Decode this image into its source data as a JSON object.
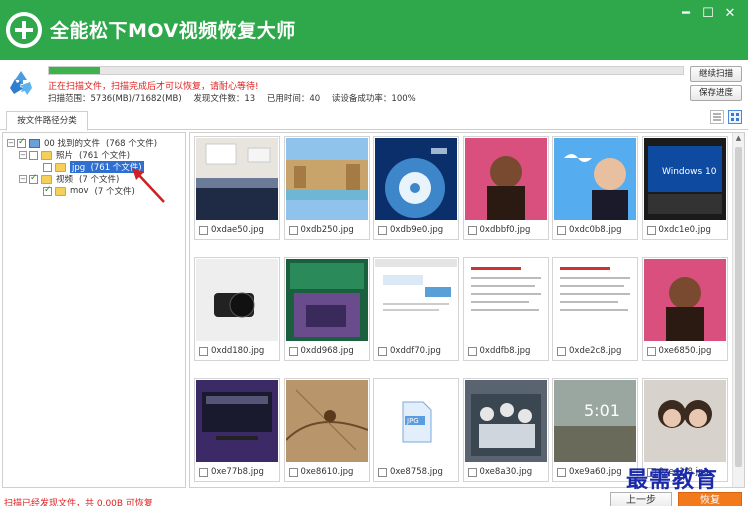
{
  "window": {
    "title": "全能松下MOV视频恢复大师",
    "brand_color": "#2ea84a"
  },
  "scan": {
    "progress": 0.08,
    "warning": "正在扫描文件，扫描完成后才可以恢复，请耐心等待!",
    "range": "扫描范围：5736(MB)/71682(MB)",
    "found": "发现文件数：13",
    "elapsed": "已用时间：40",
    "read_rate": "读设备成功率：100%",
    "continue_label": "继续扫描",
    "save_progress_label": "保存进度"
  },
  "tabs": [
    {
      "label": "按文件路径分类",
      "active": true
    }
  ],
  "tree": {
    "root": {
      "label": "00 找到的文件",
      "count": "(768 个文件)"
    },
    "pictures": {
      "label": "照片",
      "count": "(761 个文件)"
    },
    "jpg": {
      "label": "jpg",
      "count": "(761 个文件)"
    },
    "videos": {
      "label": "视频",
      "count": "(7 个文件)"
    },
    "mov": {
      "label": "mov",
      "count": "(7 个文件)"
    }
  },
  "thumbnails": [
    {
      "name": "0xdae50.jpg",
      "icon": "kitchen-photo"
    },
    {
      "name": "0xdb250.jpg",
      "icon": "fountain-photo"
    },
    {
      "name": "0xdb9e0.jpg",
      "icon": "satellite-photo"
    },
    {
      "name": "0xdbbf0.jpg",
      "icon": "portrait-photo"
    },
    {
      "name": "0xdc0b8.jpg",
      "icon": "twitter-photo"
    },
    {
      "name": "0xdc1e0.jpg",
      "icon": "windows-screenshot"
    },
    {
      "name": "0xdd180.jpg",
      "icon": "camera-photo"
    },
    {
      "name": "0xdd968.jpg",
      "icon": "poster-image"
    },
    {
      "name": "0xddf70.jpg",
      "icon": "webpage-screenshot"
    },
    {
      "name": "0xddfb8.jpg",
      "icon": "document-screenshot"
    },
    {
      "name": "0xde2c8.jpg",
      "icon": "document-screenshot"
    },
    {
      "name": "0xe6850.jpg",
      "icon": "portrait-photo"
    },
    {
      "name": "0xe77b8.jpg",
      "icon": "desktop-screenshot"
    },
    {
      "name": "0xe8610.jpg",
      "icon": "map-photo"
    },
    {
      "name": "0xe8758.jpg",
      "icon": "jpg-file-icon"
    },
    {
      "name": "0xe8a30.jpg",
      "icon": "astronauts-photo"
    },
    {
      "name": "0xe9a60.jpg",
      "icon": "lockscreen-photo"
    },
    {
      "name": "0xea1f8.jpg",
      "icon": "couple-photo"
    }
  ],
  "footer": {
    "status": "扫描已经发现文件，共 0.00B 可恢复",
    "prev_label": "上一步",
    "recover_label": "恢复",
    "watermark": "最需教育"
  }
}
